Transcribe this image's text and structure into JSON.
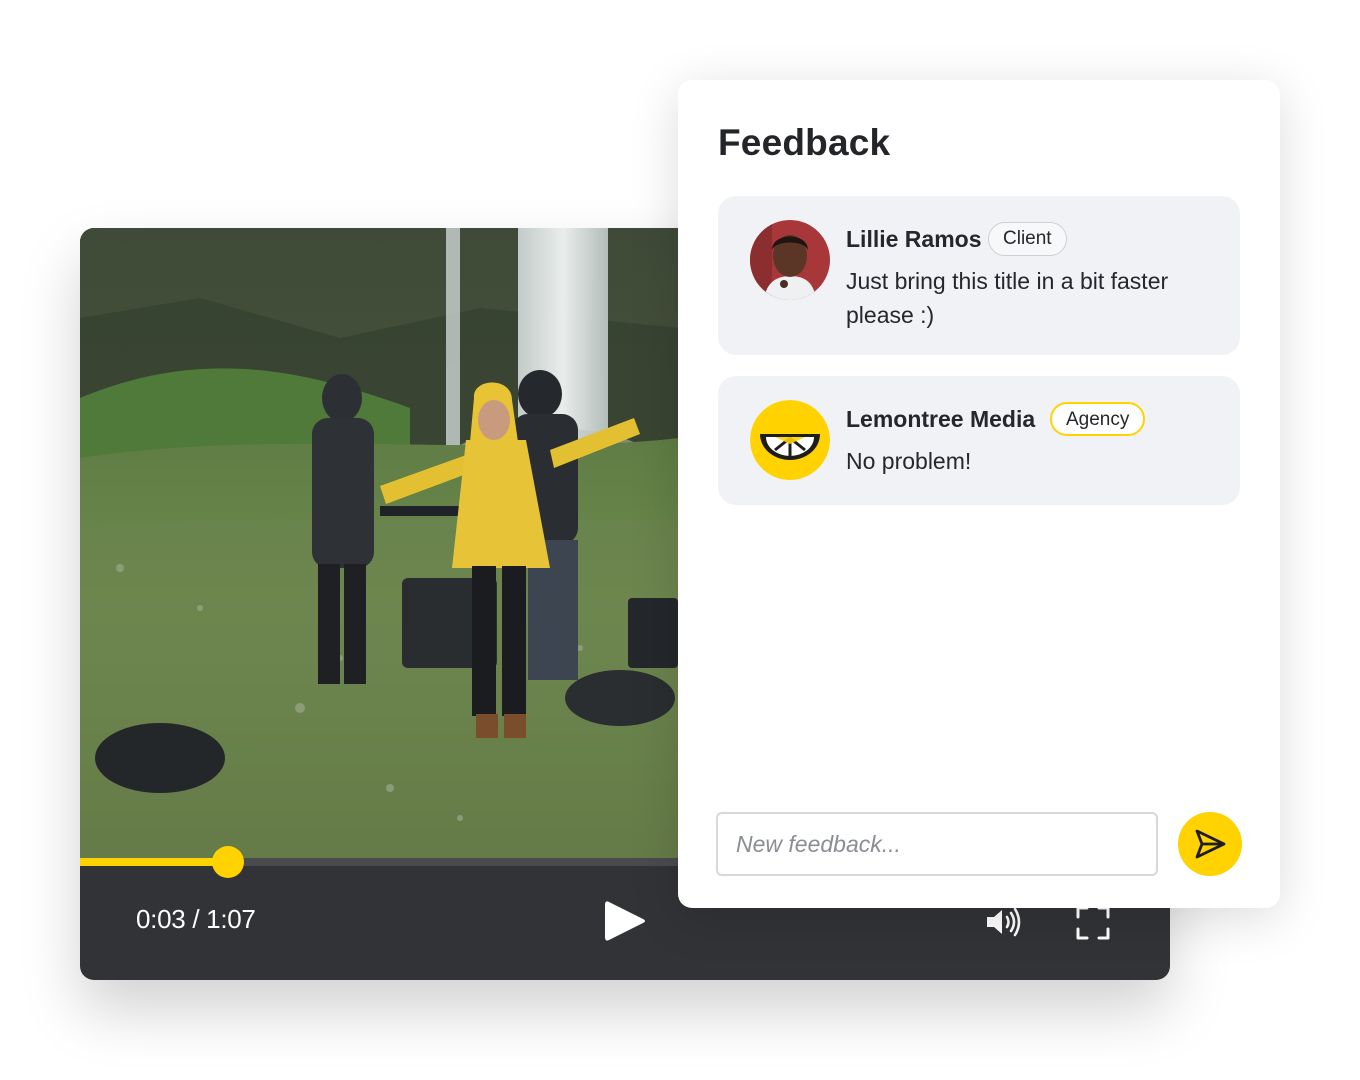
{
  "player": {
    "timecode": "0:03 / 1:07",
    "progress": 0.136,
    "icons": {
      "play": "play-icon",
      "volume": "volume-icon",
      "fullscreen": "fullscreen-icon"
    }
  },
  "feedback": {
    "title": "Feedback",
    "comments": [
      {
        "author": "Lillie Ramos",
        "role": "Client",
        "message": "Just bring this title in a bit faster please :)"
      },
      {
        "author": "Lemontree Media",
        "role": "Agency",
        "message": "No problem!"
      }
    ],
    "input": {
      "placeholder": "New feedback...",
      "value": ""
    },
    "send_icon": "send-icon"
  },
  "colors": {
    "accent": "#ffd200",
    "player_bar": "#323336",
    "comment_bg": "#f1f2f5",
    "text": "#25272c"
  }
}
